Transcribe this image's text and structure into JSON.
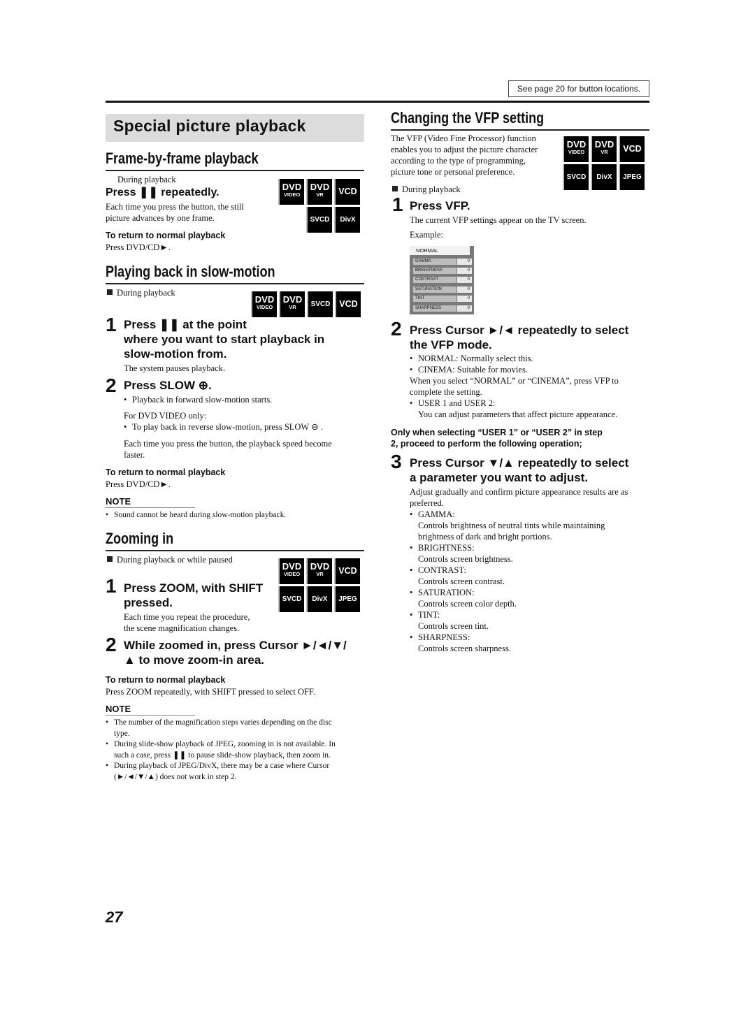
{
  "header": {
    "see_page": "See page 20 for button locations."
  },
  "title": "Special picture playback",
  "frame": {
    "heading": "Frame-by-frame playback",
    "during": "During playback",
    "step_head": "Press ❚❚ repeatedly.",
    "body": [
      "Each time you press the button, the still",
      "picture advances by one frame."
    ],
    "return_head": "To return to normal playback",
    "return_body": "Press DVD/CD►.",
    "badges": [
      "DVD|VIDEO",
      "DVD|VR",
      "VCD",
      "SVCD",
      "DivX"
    ]
  },
  "slow": {
    "heading": "Playing back in slow-motion",
    "during": "During playback",
    "badges": [
      "DVD|VIDEO",
      "DVD|VR",
      "SVCD",
      "VCD"
    ],
    "step1_num": "1",
    "step1_head": [
      "Press ❚❚ at the point",
      "where you want to start playback in",
      "slow-motion from."
    ],
    "step1_body": "The system pauses playback.",
    "step2_num": "2",
    "step2_head": "Press SLOW ⊕.",
    "step2_bullet": "Playback in forward slow-motion starts.",
    "dvd_only": "For DVD VIDEO only:",
    "reverse_bullet": "To play back in reverse slow-motion, press SLOW ⊖ .",
    "speed_text": [
      "Each time you press the button, the playback speed become",
      "faster."
    ],
    "return_head": "To return to normal playback",
    "return_body": "Press DVD/CD►.",
    "note_label": "NOTE",
    "note": "Sound cannot be heard during slow-motion playback."
  },
  "zoom": {
    "heading": "Zooming in",
    "during": "During playback or while paused",
    "badges": [
      "DVD|VIDEO",
      "DVD|VR",
      "VCD",
      "SVCD",
      "DivX",
      "JPEG"
    ],
    "step1_num": "1",
    "step1_head": [
      "Press ZOOM, with SHIFT",
      "pressed."
    ],
    "step1_body": [
      "Each time you repeat the procedure,",
      "the scene magnification changes."
    ],
    "step2_num": "2",
    "step2_head": [
      "While zoomed in, press Cursor ►/◄/▼/",
      "▲ to move zoom-in area."
    ],
    "return_head": "To return to normal playback",
    "return_body": "Press ZOOM repeatedly, with SHIFT pressed to select OFF.",
    "note_label": "NOTE",
    "notes": [
      [
        "The number of the magnification steps varies depending on the disc",
        "type."
      ],
      [
        "During slide-show playback of JPEG, zooming in is not available. In",
        "such a case, press ❚❚ to pause slide-show playback, then zoom in."
      ],
      [
        "During playback of JPEG/DivX, there may be a case where Cursor",
        "(►/◄/▼/▲) does not work in step 2."
      ]
    ]
  },
  "vfp": {
    "heading": "Changing the VFP setting",
    "intro": [
      "The VFP (Video Fine Processor) function",
      "enables you to adjust the picture character",
      "according to the type of programming,",
      "picture tone or personal preference."
    ],
    "badges": [
      "DVD|VIDEO",
      "DVD|VR",
      "VCD",
      "SVCD",
      "DivX",
      "JPEG"
    ],
    "during": "During playback",
    "step1_num": "1",
    "step1_head": "Press VFP.",
    "step1_body": "The current VFP settings appear on the TV screen.",
    "example": "Example:",
    "screen": {
      "mode": "NORMAL",
      "rows": [
        {
          "name": "GAMMA",
          "value": "0"
        },
        {
          "name": "BRIGHTNESS",
          "value": "0"
        },
        {
          "name": "CONTRAST",
          "value": "0"
        },
        {
          "name": "SATURATION",
          "value": "0"
        },
        {
          "name": "TINT",
          "value": "0"
        },
        {
          "name": "SHARPNESS",
          "value": "0"
        }
      ]
    },
    "step2_num": "2",
    "step2_head": [
      "Press Cursor ►/◄ repeatedly to select",
      "the VFP mode."
    ],
    "step2_bullets": [
      "NORMAL: Normally select this.",
      "CINEMA:  Suitable for movies."
    ],
    "step2_text": [
      "When you select “NORMAL” or “CINEMA”, press VFP to",
      "complete the setting."
    ],
    "step2_user": "USER 1 and USER 2:",
    "step2_user_desc": "You can adjust parameters that affect picture appearance.",
    "only_when": [
      "Only when selecting “USER 1” or “USER 2” in step",
      "2, proceed to perform the following operation;"
    ],
    "step3_num": "3",
    "step3_head": [
      "Press Cursor ▼/▲ repeatedly to select",
      "a parameter you want to adjust."
    ],
    "step3_body": [
      "Adjust gradually and confirm picture appearance results are as",
      "preferred."
    ],
    "params": [
      {
        "name": "GAMMA:",
        "desc": [
          "Controls brightness of neutral tints while maintaining",
          "brightness of dark and bright portions."
        ]
      },
      {
        "name": "BRIGHTNESS:",
        "desc": [
          "Controls screen brightness."
        ]
      },
      {
        "name": "CONTRAST:",
        "desc": [
          "Controls screen contrast."
        ]
      },
      {
        "name": "SATURATION:",
        "desc": [
          "Controls screen color depth."
        ]
      },
      {
        "name": "TINT:",
        "desc": [
          "Controls screen tint."
        ]
      },
      {
        "name": "SHARPNESS:",
        "desc": [
          "Controls screen sharpness."
        ]
      }
    ]
  },
  "page_number": "27"
}
